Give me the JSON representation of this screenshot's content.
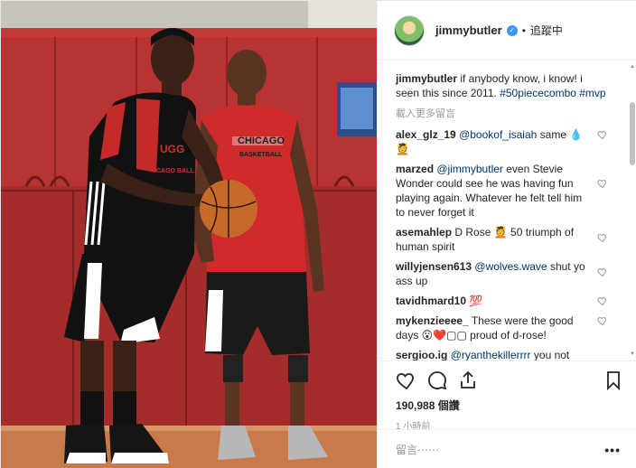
{
  "post": {
    "username": "jimmybutler",
    "following_label": "追蹤中",
    "caption_user": "jimmybutler",
    "caption_text": " if anybody know, i know! i seen this since 2011. ",
    "caption_tags": "#50piececombo #mvp",
    "load_more": "載入更多留言",
    "views": "190,988 個讚",
    "time": "1 小時前",
    "add_comment_placeholder": "留言⋯⋯",
    "menu_label": "•••"
  },
  "comments": [
    {
      "user": "alex_glz_19",
      "mention": "@bookof_isaiah",
      "text": " same 💧💆"
    },
    {
      "user": "marzed",
      "mention": "@jimmybutler",
      "text": " even Stevie Wonder could see he was having fun playing again. Whatever he felt tell him to never forget it"
    },
    {
      "user": "asemahlep",
      "mention": "",
      "text": "D Rose 💆 50 triumph of human spirit"
    },
    {
      "user": "willyjensen613",
      "mention": "@wolves.wave",
      "text": " shut yo ass up"
    },
    {
      "user": "tavidhmard10",
      "mention": "",
      "text": "💯"
    },
    {
      "user": "mykenzieeee_",
      "mention": "",
      "text": "These were the good days 😮❤️▢▢ proud of d-rose!"
    },
    {
      "user": "sergioo.ig",
      "mention": "@ryanthekillerrrr",
      "text": " you not from chi you don't feel the same way we do"
    }
  ],
  "photo": {
    "jersey_left_text": "UGG",
    "jersey_left_sub": "CAGO BALL",
    "jersey_right_text": "CHICAGO",
    "jersey_right_sub": "BASKETBALL"
  },
  "colors": {
    "link": "#003569",
    "verified": "#3897f0",
    "court_wall": "#b1302e"
  }
}
